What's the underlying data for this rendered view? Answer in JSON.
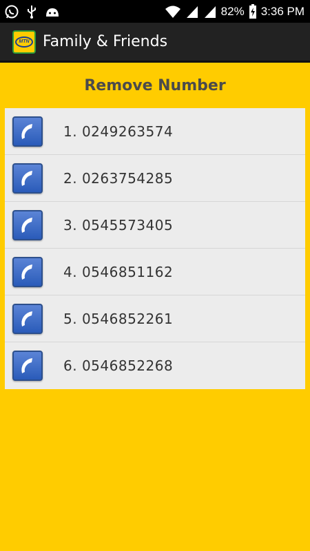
{
  "status_bar": {
    "battery": "82%",
    "time": "3:36 PM",
    "icons": [
      "whatsapp-icon",
      "usb-icon",
      "android-icon",
      "wifi-icon",
      "signal-icon",
      "signal-icon",
      "battery-icon"
    ]
  },
  "app_bar": {
    "title": "Family & Friends",
    "logo_text": "MTN"
  },
  "heading": "Remove Number",
  "numbers": [
    {
      "label": "1. 0249263574"
    },
    {
      "label": "2. 0263754285"
    },
    {
      "label": "3. 0545573405"
    },
    {
      "label": "4. 0546851162"
    },
    {
      "label": "5. 0546852261"
    },
    {
      "label": "6. 0546852268"
    }
  ],
  "colors": {
    "background": "#FFCC00",
    "app_bar": "#222222",
    "list_bg": "#ECECEC",
    "icon_blue": "#2A5BB9"
  }
}
